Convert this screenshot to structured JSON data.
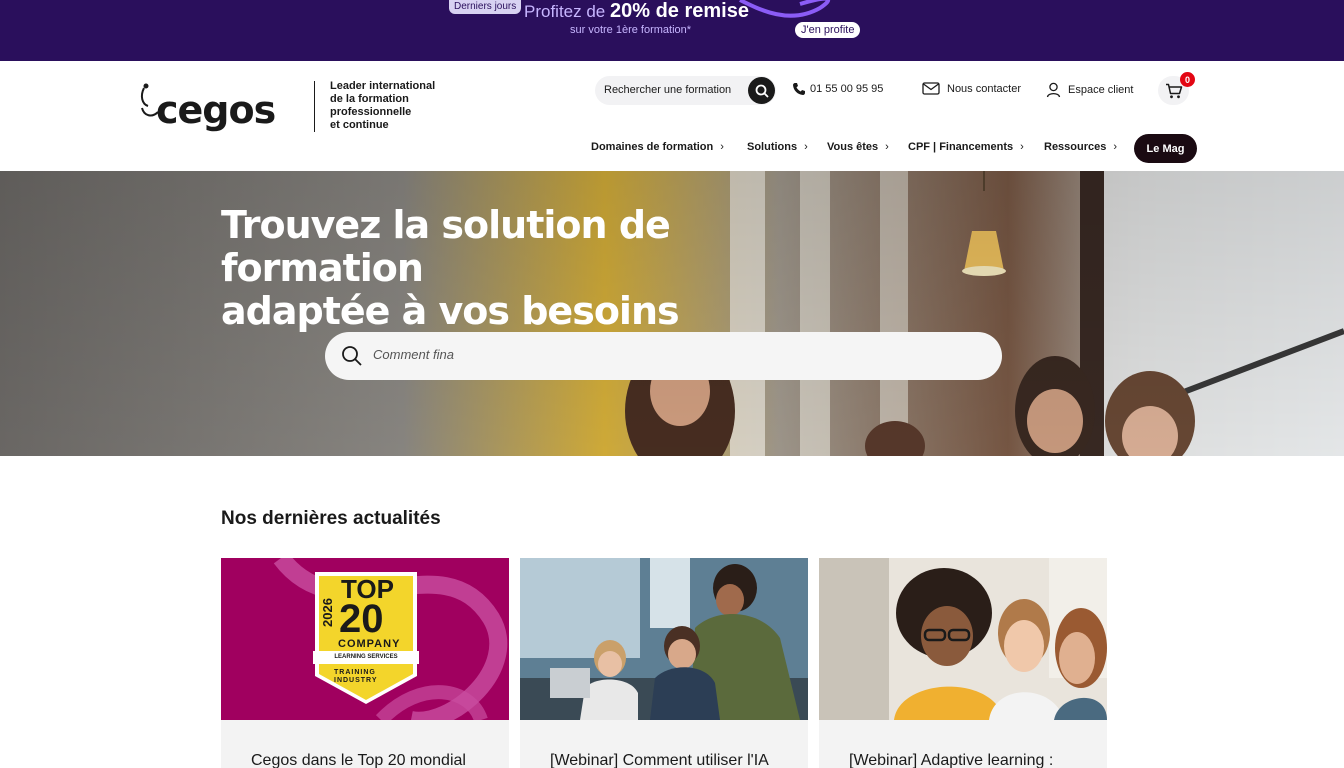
{
  "promo": {
    "tag": "Derniers jours",
    "headline_prefix": "Profitez de",
    "headline_strong": "20% de remise",
    "sub": "sur votre 1ère formation*",
    "cta": "J'en profite"
  },
  "header": {
    "logo_text": "cegos",
    "tagline": [
      "Leader international",
      "de la formation",
      "professionnelle",
      "et continue"
    ],
    "search_placeholder": "Rechercher une formation",
    "phone": "01 55 00 95 95",
    "contact": "Nous contacter",
    "account": "Espace client",
    "cart_count": "0"
  },
  "nav": {
    "items": [
      {
        "label": "Domaines de formation"
      },
      {
        "label": "Solutions"
      },
      {
        "label": "Vous êtes"
      },
      {
        "label": "CPF | Financements"
      },
      {
        "label": "Ressources"
      }
    ],
    "mag": "Le Mag"
  },
  "hero": {
    "title_line1": "Trouvez la solution de formation",
    "title_line2": "adaptée à vos besoins",
    "search_value": "Comment fina"
  },
  "news": {
    "title": "Nos dernières actualités",
    "cards": [
      {
        "title": "Cegos dans le Top 20 mondial",
        "badge_year": "2026",
        "badge_top": "TOP",
        "badge_num": "20",
        "badge_company": "COMPANY",
        "badge_service": "LEARNING SERVICES",
        "badge_org": "TRAINING INDUSTRY"
      },
      {
        "title": "[Webinar] Comment utiliser l'IA"
      },
      {
        "title": "[Webinar] Adaptive learning :"
      }
    ]
  },
  "colors": {
    "promo_bg": "#2a0f5c",
    "accent_magenta": "#a0005f",
    "cart_badge": "#e30613",
    "dark_button": "#1a0a12"
  },
  "icons": [
    "search-icon",
    "phone-icon",
    "mail-icon",
    "user-icon",
    "cart-icon",
    "chevron-right-icon"
  ]
}
